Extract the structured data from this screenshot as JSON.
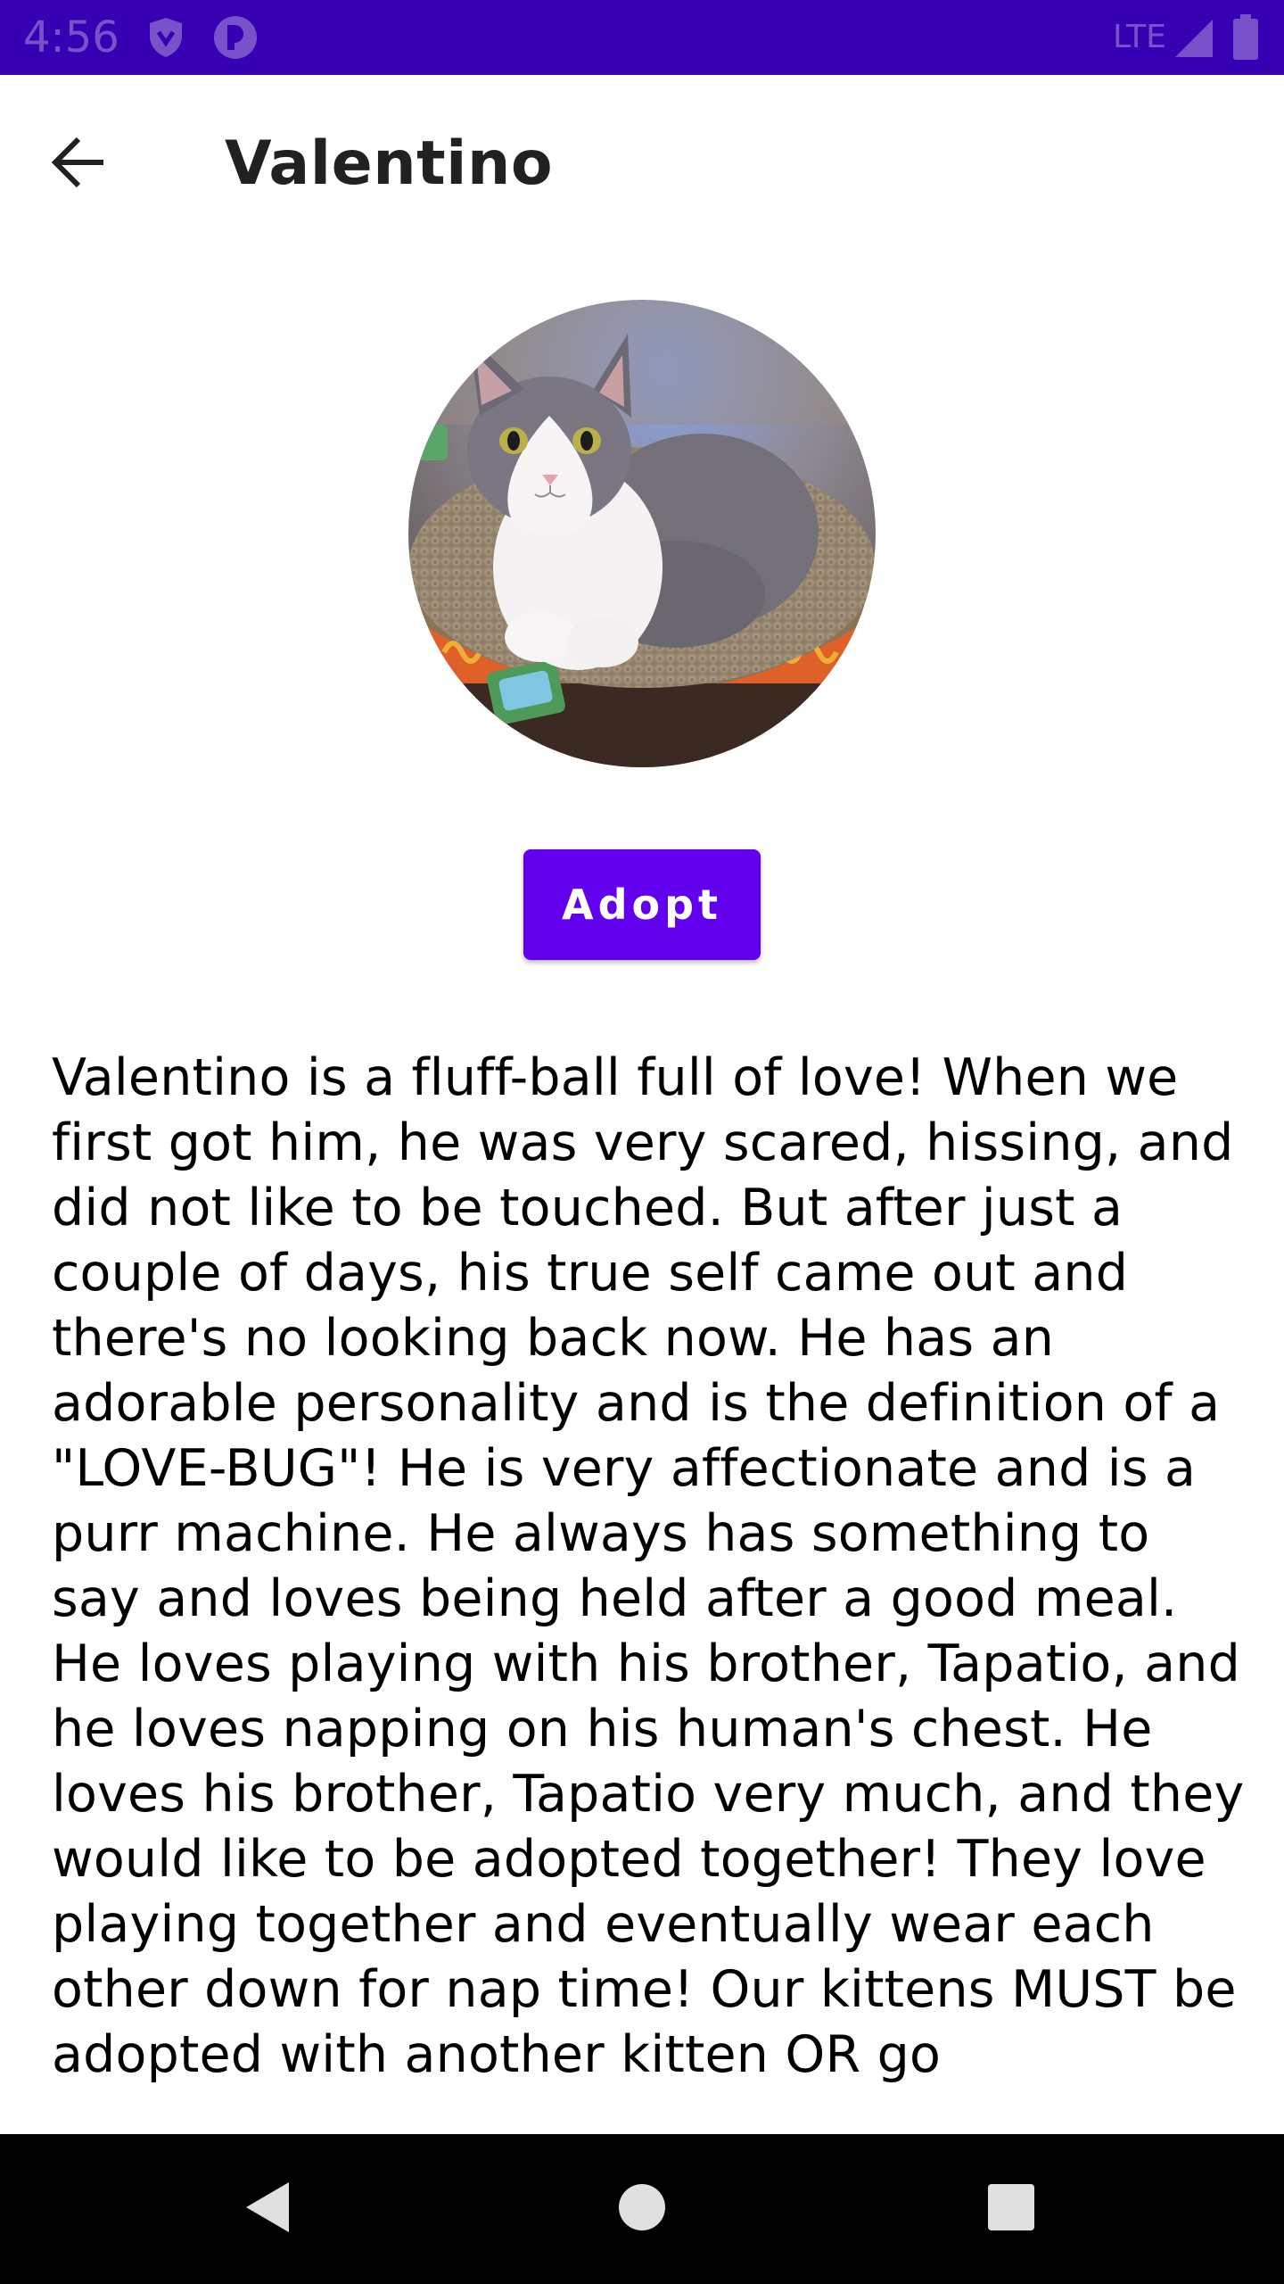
{
  "status_bar": {
    "time": "4:56",
    "network_label": "LTE",
    "icons": [
      "shield-icon",
      "pocket-icon",
      "signal-icon",
      "battery-icon"
    ]
  },
  "app_bar": {
    "title": "Valentino",
    "back_icon": "arrow-back-icon"
  },
  "pet": {
    "photo_icon": "cat-photo",
    "adopt_label": "Adopt",
    "description": "Valentino is a fluff-ball full of love! When we first got him, he was very scared, hissing, and did not like to be touched. But after just a couple of days, his true self came out and there's no looking back now. He has an adorable personality and is the definition of a \"LOVE-BUG\"! He is very affectionate and is a purr machine. He always has something to say and loves being held after a good meal. He loves playing with his brother, Tapatio, and he loves napping on his human's chest. He loves his brother, Tapatio very much, and they would like to be adopted together! They love playing together and eventually wear each other down for nap time! Our kittens MUST be adopted with another kitten OR go"
  },
  "nav_bar": {
    "icons": [
      "back-triangle-icon",
      "home-circle-icon",
      "recents-square-icon"
    ]
  },
  "colors": {
    "status_bar": "#3700b3",
    "primary": "#6200ee",
    "title_text": "#212121",
    "nav_bar": "#000000"
  }
}
